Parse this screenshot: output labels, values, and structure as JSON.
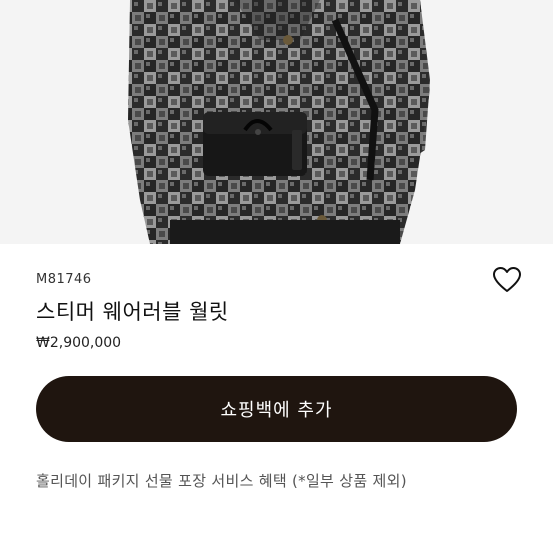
{
  "product": {
    "sku": "M81746",
    "name": "스티머 웨어러블 월릿",
    "price": "₩2,900,000"
  },
  "actions": {
    "add_to_cart_label": "쇼핑백에 추가",
    "wishlist_icon": "heart-icon"
  },
  "promo": {
    "text": "홀리데이 패키지 선물 포장 서비스 혜택 (*일부 상품 제외)"
  },
  "colors": {
    "button_bg": "#1f150f",
    "button_text": "#ffffff"
  }
}
